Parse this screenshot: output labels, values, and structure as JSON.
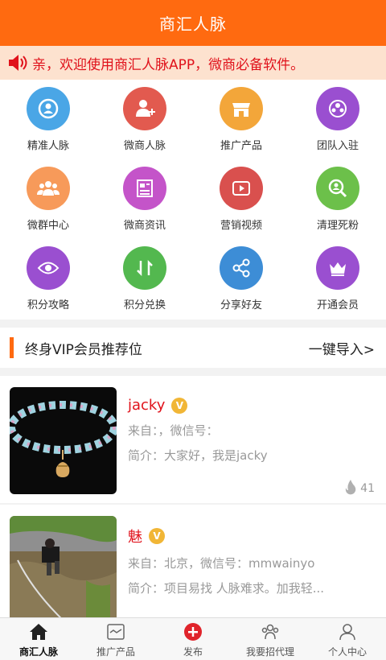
{
  "header": {
    "title": "商汇人脉"
  },
  "notice": {
    "icon": "speaker-icon",
    "text": "亲，欢迎使用商汇人脉APP，微商必备软件。"
  },
  "grid": [
    {
      "label": "精准人脉",
      "icon": "person-target-icon",
      "color": "#4aa6e6"
    },
    {
      "label": "微商人脉",
      "icon": "add-user-icon",
      "color": "#e25a4f"
    },
    {
      "label": "推广产品",
      "icon": "store-icon",
      "color": "#f3a63a"
    },
    {
      "label": "团队入驻",
      "icon": "team-icon",
      "color": "#9a4fd0"
    },
    {
      "label": "微群中心",
      "icon": "group-icon",
      "color": "#f79a5a"
    },
    {
      "label": "微商资讯",
      "icon": "news-icon",
      "color": "#c454c9"
    },
    {
      "label": "营销视频",
      "icon": "video-icon",
      "color": "#d9504e"
    },
    {
      "label": "清理死粉",
      "icon": "search-user-icon",
      "color": "#6cc04a"
    },
    {
      "label": "积分攻略",
      "icon": "eye-icon",
      "color": "#9a4fd0"
    },
    {
      "label": "积分兑换",
      "icon": "exchange-icon",
      "color": "#53b84f"
    },
    {
      "label": "分享好友",
      "icon": "share-icon",
      "color": "#3d8dd6"
    },
    {
      "label": "开通会员",
      "icon": "crown-icon",
      "color": "#9a4fd0"
    }
  ],
  "section": {
    "title": "终身VIP会员推荐位",
    "action": "一键导入>"
  },
  "cards": [
    {
      "name": "jacky",
      "badge": "V",
      "line1": "来自：，微信号：",
      "line2": "简介：大家好，我是jacky",
      "likes": "41"
    },
    {
      "name": "魅",
      "badge": "V",
      "line1": "来自：北京，微信号：mmwainyo",
      "line2": "简介：项目易找 人脉难求。加我轻...",
      "likes": ""
    }
  ],
  "tabs": [
    {
      "label": "商汇人脉",
      "icon": "home-icon",
      "active": true
    },
    {
      "label": "推广产品",
      "icon": "product-icon",
      "active": false
    },
    {
      "label": "发布",
      "icon": "publish-icon",
      "active": false
    },
    {
      "label": "我要招代理",
      "icon": "agent-icon",
      "active": false
    },
    {
      "label": "个人中心",
      "icon": "user-icon",
      "active": false
    }
  ]
}
